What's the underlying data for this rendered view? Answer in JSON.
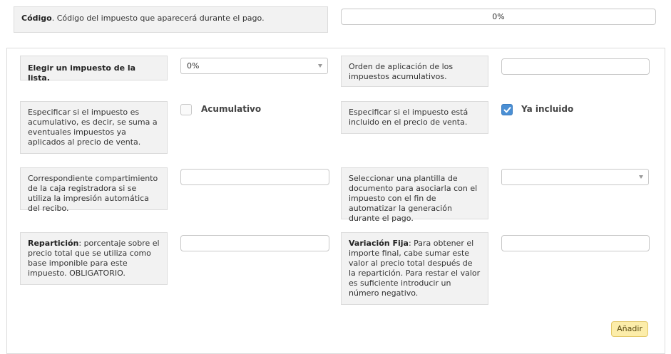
{
  "codigo": {
    "label_bold": "Código",
    "label_rest": ". Código del impuesto que aparecerá durante el pago.",
    "value": "0%"
  },
  "form": {
    "elegir": {
      "label": "Elegir un impuesto de la lista.",
      "selected": "0%"
    },
    "orden": {
      "label": "Orden de aplicación de los impuestos acumulativos.",
      "value": ""
    },
    "acumulativo": {
      "label": "Especificar si el impuesto es acumulativo, es decir, se suma a eventuales impuestos ya aplicados al precio de venta.",
      "checkbox_label": "Acumulativo",
      "checked": false
    },
    "incluido": {
      "label": "Especificar si el impuesto está incluido en el precio de venta.",
      "checkbox_label": "Ya incluido",
      "checked": true
    },
    "compartimiento": {
      "label": "Correspondiente compartimiento de la caja registradora si se utiliza la impresión automática del recibo.",
      "value": ""
    },
    "plantilla": {
      "label": "Seleccionar una plantilla de documento para asociarla con el impuesto con el fin de automatizar la generación durante el pago.",
      "selected": ""
    },
    "reparticion": {
      "label_bold": "Repartición",
      "label_rest": ": porcentaje sobre el precio total que se utiliza como base imponible para este impuesto. OBLIGATORIO.",
      "value": ""
    },
    "variacion": {
      "label_bold": "Variación Fija",
      "label_rest": ": Para obtener el importe final, cabe sumar este valor al precio total después de la repartición. Para restar el valor es suficiente introducir un número negativo.",
      "value": ""
    },
    "add_button": "Añadir"
  },
  "colors": {
    "accent": "#4a8fd4",
    "button_bg": "#fcedaa",
    "label_bg": "#f2f2f2"
  }
}
